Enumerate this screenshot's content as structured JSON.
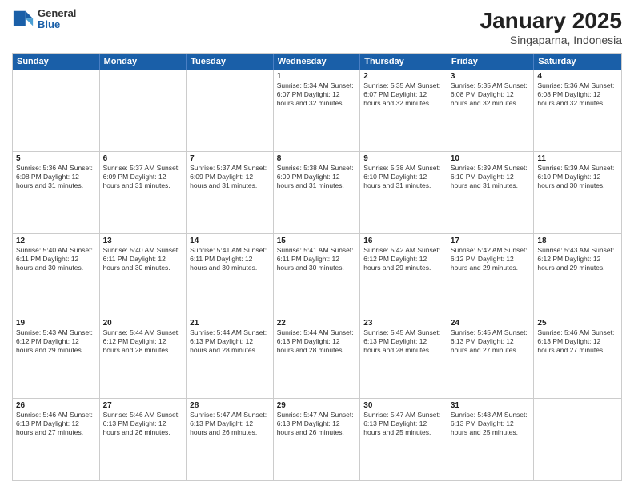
{
  "logo": {
    "general": "General",
    "blue": "Blue"
  },
  "title": "January 2025",
  "subtitle": "Singaparna, Indonesia",
  "dayHeaders": [
    "Sunday",
    "Monday",
    "Tuesday",
    "Wednesday",
    "Thursday",
    "Friday",
    "Saturday"
  ],
  "weeks": [
    [
      {
        "day": "",
        "info": ""
      },
      {
        "day": "",
        "info": ""
      },
      {
        "day": "",
        "info": ""
      },
      {
        "day": "1",
        "info": "Sunrise: 5:34 AM\nSunset: 6:07 PM\nDaylight: 12 hours\nand 32 minutes."
      },
      {
        "day": "2",
        "info": "Sunrise: 5:35 AM\nSunset: 6:07 PM\nDaylight: 12 hours\nand 32 minutes."
      },
      {
        "day": "3",
        "info": "Sunrise: 5:35 AM\nSunset: 6:08 PM\nDaylight: 12 hours\nand 32 minutes."
      },
      {
        "day": "4",
        "info": "Sunrise: 5:36 AM\nSunset: 6:08 PM\nDaylight: 12 hours\nand 32 minutes."
      }
    ],
    [
      {
        "day": "5",
        "info": "Sunrise: 5:36 AM\nSunset: 6:08 PM\nDaylight: 12 hours\nand 31 minutes."
      },
      {
        "day": "6",
        "info": "Sunrise: 5:37 AM\nSunset: 6:09 PM\nDaylight: 12 hours\nand 31 minutes."
      },
      {
        "day": "7",
        "info": "Sunrise: 5:37 AM\nSunset: 6:09 PM\nDaylight: 12 hours\nand 31 minutes."
      },
      {
        "day": "8",
        "info": "Sunrise: 5:38 AM\nSunset: 6:09 PM\nDaylight: 12 hours\nand 31 minutes."
      },
      {
        "day": "9",
        "info": "Sunrise: 5:38 AM\nSunset: 6:10 PM\nDaylight: 12 hours\nand 31 minutes."
      },
      {
        "day": "10",
        "info": "Sunrise: 5:39 AM\nSunset: 6:10 PM\nDaylight: 12 hours\nand 31 minutes."
      },
      {
        "day": "11",
        "info": "Sunrise: 5:39 AM\nSunset: 6:10 PM\nDaylight: 12 hours\nand 30 minutes."
      }
    ],
    [
      {
        "day": "12",
        "info": "Sunrise: 5:40 AM\nSunset: 6:11 PM\nDaylight: 12 hours\nand 30 minutes."
      },
      {
        "day": "13",
        "info": "Sunrise: 5:40 AM\nSunset: 6:11 PM\nDaylight: 12 hours\nand 30 minutes."
      },
      {
        "day": "14",
        "info": "Sunrise: 5:41 AM\nSunset: 6:11 PM\nDaylight: 12 hours\nand 30 minutes."
      },
      {
        "day": "15",
        "info": "Sunrise: 5:41 AM\nSunset: 6:11 PM\nDaylight: 12 hours\nand 30 minutes."
      },
      {
        "day": "16",
        "info": "Sunrise: 5:42 AM\nSunset: 6:12 PM\nDaylight: 12 hours\nand 29 minutes."
      },
      {
        "day": "17",
        "info": "Sunrise: 5:42 AM\nSunset: 6:12 PM\nDaylight: 12 hours\nand 29 minutes."
      },
      {
        "day": "18",
        "info": "Sunrise: 5:43 AM\nSunset: 6:12 PM\nDaylight: 12 hours\nand 29 minutes."
      }
    ],
    [
      {
        "day": "19",
        "info": "Sunrise: 5:43 AM\nSunset: 6:12 PM\nDaylight: 12 hours\nand 29 minutes."
      },
      {
        "day": "20",
        "info": "Sunrise: 5:44 AM\nSunset: 6:12 PM\nDaylight: 12 hours\nand 28 minutes."
      },
      {
        "day": "21",
        "info": "Sunrise: 5:44 AM\nSunset: 6:13 PM\nDaylight: 12 hours\nand 28 minutes."
      },
      {
        "day": "22",
        "info": "Sunrise: 5:44 AM\nSunset: 6:13 PM\nDaylight: 12 hours\nand 28 minutes."
      },
      {
        "day": "23",
        "info": "Sunrise: 5:45 AM\nSunset: 6:13 PM\nDaylight: 12 hours\nand 28 minutes."
      },
      {
        "day": "24",
        "info": "Sunrise: 5:45 AM\nSunset: 6:13 PM\nDaylight: 12 hours\nand 27 minutes."
      },
      {
        "day": "25",
        "info": "Sunrise: 5:46 AM\nSunset: 6:13 PM\nDaylight: 12 hours\nand 27 minutes."
      }
    ],
    [
      {
        "day": "26",
        "info": "Sunrise: 5:46 AM\nSunset: 6:13 PM\nDaylight: 12 hours\nand 27 minutes."
      },
      {
        "day": "27",
        "info": "Sunrise: 5:46 AM\nSunset: 6:13 PM\nDaylight: 12 hours\nand 26 minutes."
      },
      {
        "day": "28",
        "info": "Sunrise: 5:47 AM\nSunset: 6:13 PM\nDaylight: 12 hours\nand 26 minutes."
      },
      {
        "day": "29",
        "info": "Sunrise: 5:47 AM\nSunset: 6:13 PM\nDaylight: 12 hours\nand 26 minutes."
      },
      {
        "day": "30",
        "info": "Sunrise: 5:47 AM\nSunset: 6:13 PM\nDaylight: 12 hours\nand 25 minutes."
      },
      {
        "day": "31",
        "info": "Sunrise: 5:48 AM\nSunset: 6:13 PM\nDaylight: 12 hours\nand 25 minutes."
      },
      {
        "day": "",
        "info": ""
      }
    ]
  ]
}
